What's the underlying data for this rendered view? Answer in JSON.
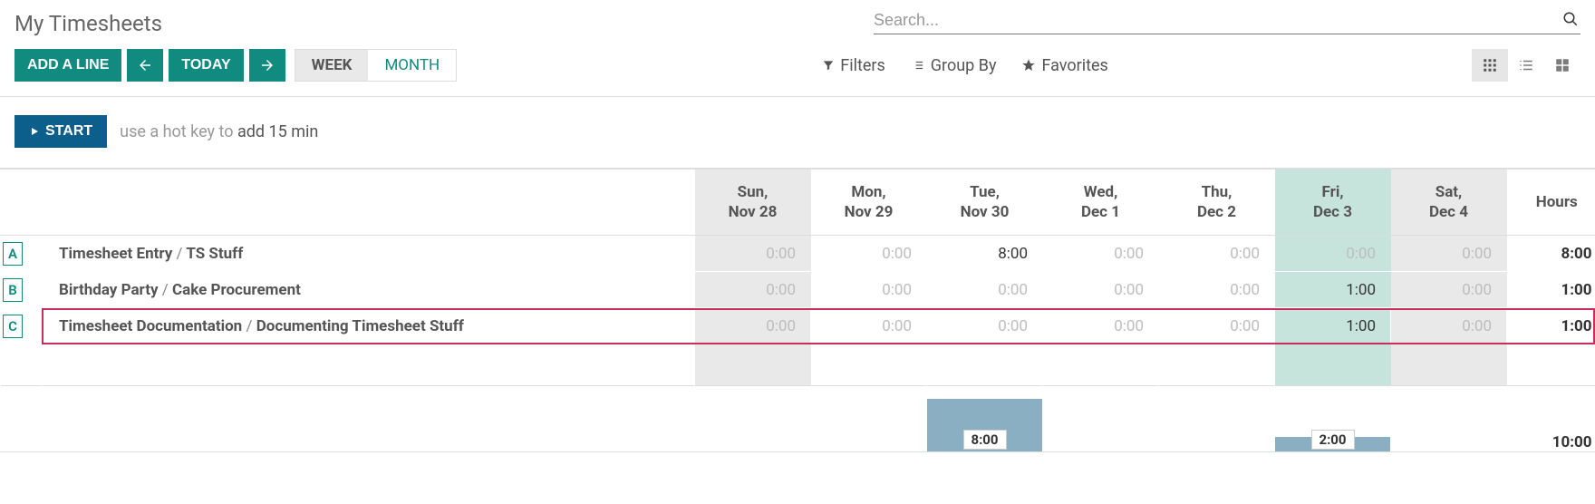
{
  "header": {
    "title": "My Timesheets",
    "search_placeholder": "Search..."
  },
  "toolbar": {
    "add_line": "ADD A LINE",
    "today": "TODAY",
    "view_week": "WEEK",
    "view_month": "MONTH",
    "filters": "Filters",
    "group_by": "Group By",
    "favorites": "Favorites"
  },
  "start_bar": {
    "start": "START",
    "hint_prefix": "use a hot key to ",
    "hint_action": "add 15 min"
  },
  "columns": {
    "days": [
      {
        "label_top": "Sun,",
        "label_bottom": "Nov 28",
        "kind": "dim"
      },
      {
        "label_top": "Mon,",
        "label_bottom": "Nov 29",
        "kind": "normal"
      },
      {
        "label_top": "Tue,",
        "label_bottom": "Nov 30",
        "kind": "normal"
      },
      {
        "label_top": "Wed,",
        "label_bottom": "Dec 1",
        "kind": "normal"
      },
      {
        "label_top": "Thu,",
        "label_bottom": "Dec 2",
        "kind": "normal"
      },
      {
        "label_top": "Fri,",
        "label_bottom": "Dec 3",
        "kind": "today"
      },
      {
        "label_top": "Sat,",
        "label_bottom": "Dec 4",
        "kind": "dim"
      }
    ],
    "hours_label": "Hours"
  },
  "rows": [
    {
      "badge": "A",
      "project": "Timesheet Entry",
      "task": "TS Stuff",
      "values": [
        "0:00",
        "0:00",
        "8:00",
        "0:00",
        "0:00",
        "0:00",
        "0:00"
      ],
      "total": "8:00",
      "highlighted": false
    },
    {
      "badge": "B",
      "project": "Birthday Party",
      "task": "Cake Procurement",
      "values": [
        "0:00",
        "0:00",
        "0:00",
        "0:00",
        "0:00",
        "1:00",
        "0:00"
      ],
      "total": "1:00",
      "highlighted": false
    },
    {
      "badge": "C",
      "project": "Timesheet Documentation",
      "task": "Documenting Timesheet Stuff",
      "values": [
        "0:00",
        "0:00",
        "0:00",
        "0:00",
        "0:00",
        "1:00",
        "0:00"
      ],
      "total": "1:00",
      "highlighted": true
    }
  ],
  "totals": {
    "day_bars": [
      {
        "value": "",
        "height": 0
      },
      {
        "value": "",
        "height": 0
      },
      {
        "value": "8:00",
        "height": 58
      },
      {
        "value": "",
        "height": 0
      },
      {
        "value": "",
        "height": 0
      },
      {
        "value": "2:00",
        "height": 16
      },
      {
        "value": "",
        "height": 0
      }
    ],
    "grand_total": "10:00"
  }
}
